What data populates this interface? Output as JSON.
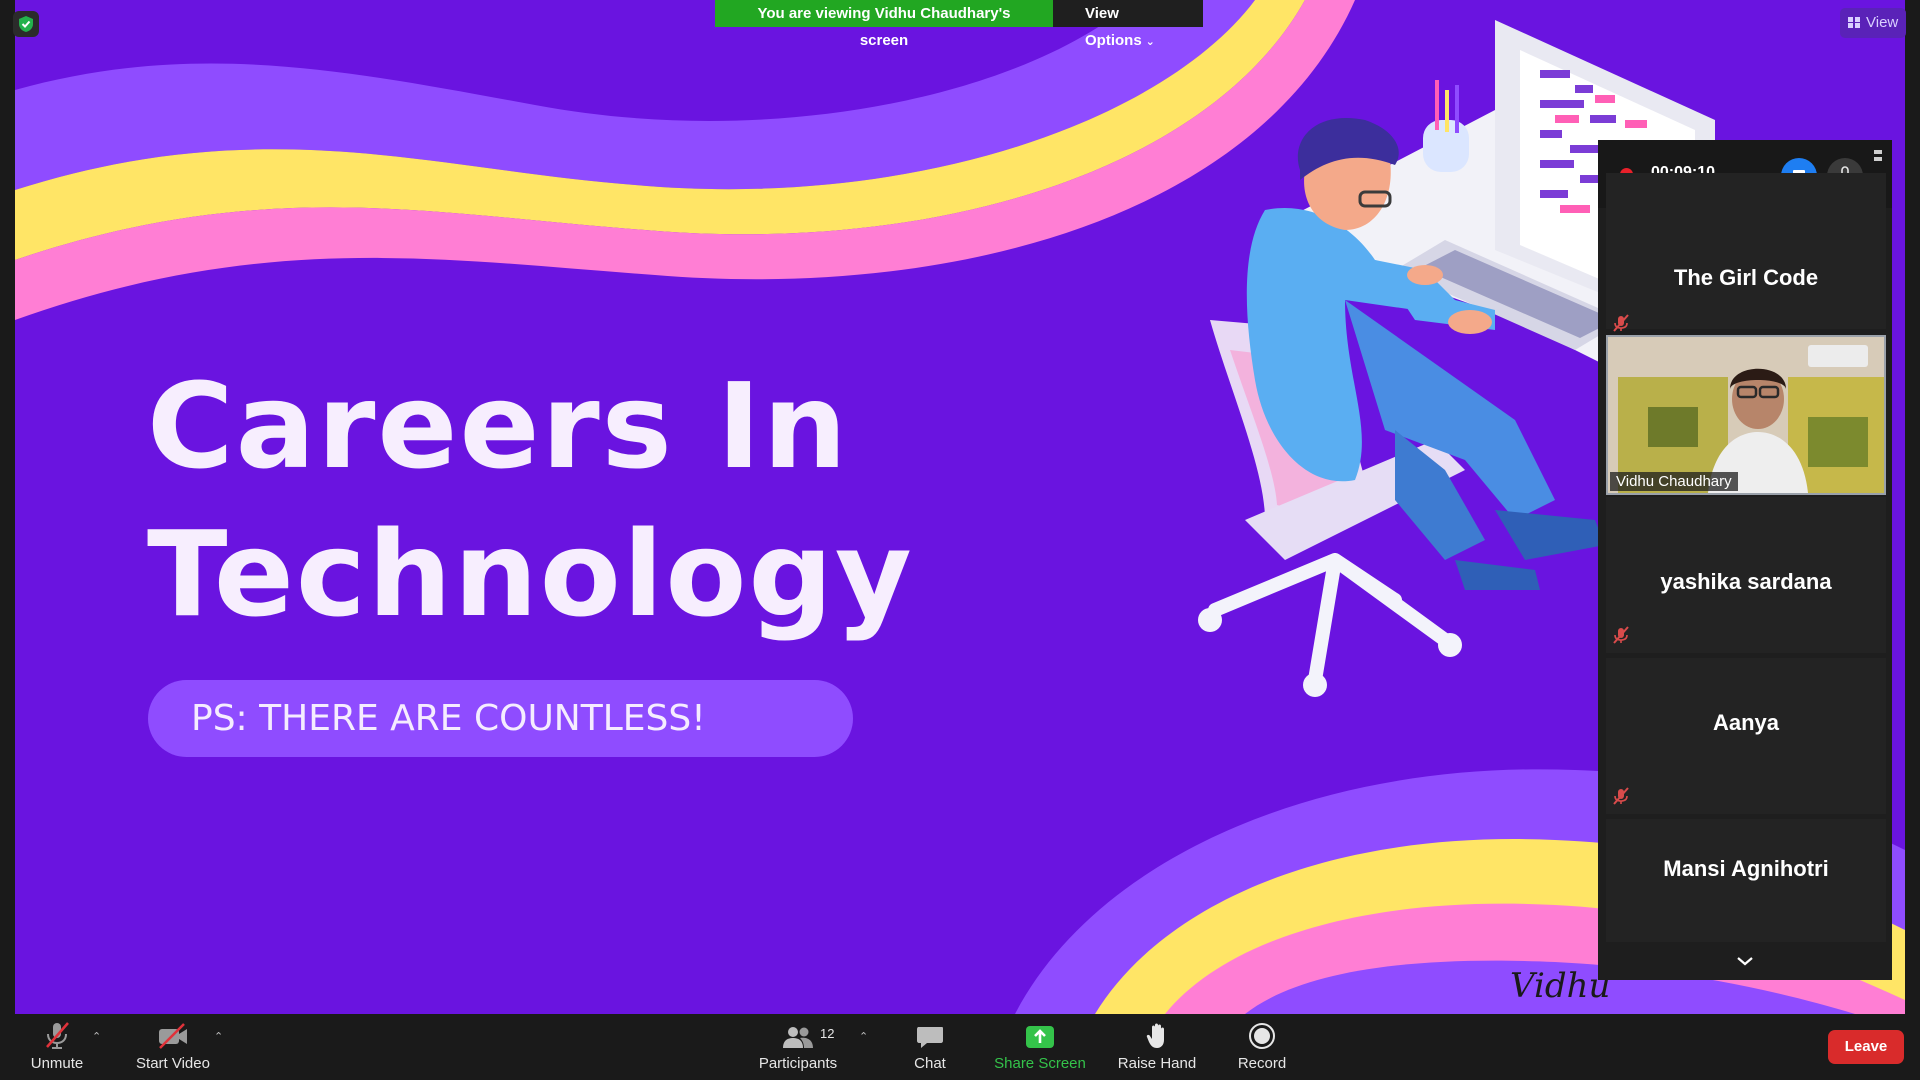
{
  "banner": {
    "viewing_text": "You are viewing Vidhu Chaudhary's screen",
    "view_options_label": "View Options"
  },
  "view_button_label": "View",
  "slide": {
    "title_line1": "Careers In",
    "title_line2": "Technology",
    "subtitle": "PS: THERE ARE COUNTLESS!",
    "signature": "Vidhu",
    "colors": {
      "background": "#6a14e0",
      "stripe_purple": "#8f4cff",
      "stripe_yellow": "#ffe566",
      "stripe_pink": "#ff7ed4"
    }
  },
  "recording": {
    "time": "00:09:10",
    "stop_icon": "stop-recording-icon",
    "mic_icon": "microphone-icon"
  },
  "participants_panel": {
    "tiles": [
      {
        "name": "The Girl Code",
        "muted": true,
        "video": false
      },
      {
        "name": "Vidhu Chaudhary",
        "muted": false,
        "video": true
      },
      {
        "name": "yashika sardana",
        "muted": true,
        "video": false
      },
      {
        "name": "Aanya",
        "muted": true,
        "video": false
      },
      {
        "name": "Mansi Agnihotri",
        "muted": true,
        "video": false
      }
    ]
  },
  "toolbar": {
    "unmute_label": "Unmute",
    "start_video_label": "Start Video",
    "participants_label": "Participants",
    "participants_count": "12",
    "chat_label": "Chat",
    "share_screen_label": "Share Screen",
    "raise_hand_label": "Raise Hand",
    "record_label": "Record",
    "leave_label": "Leave",
    "colors": {
      "share_green": "#34c34a",
      "leave_red": "#d92b2b"
    }
  }
}
